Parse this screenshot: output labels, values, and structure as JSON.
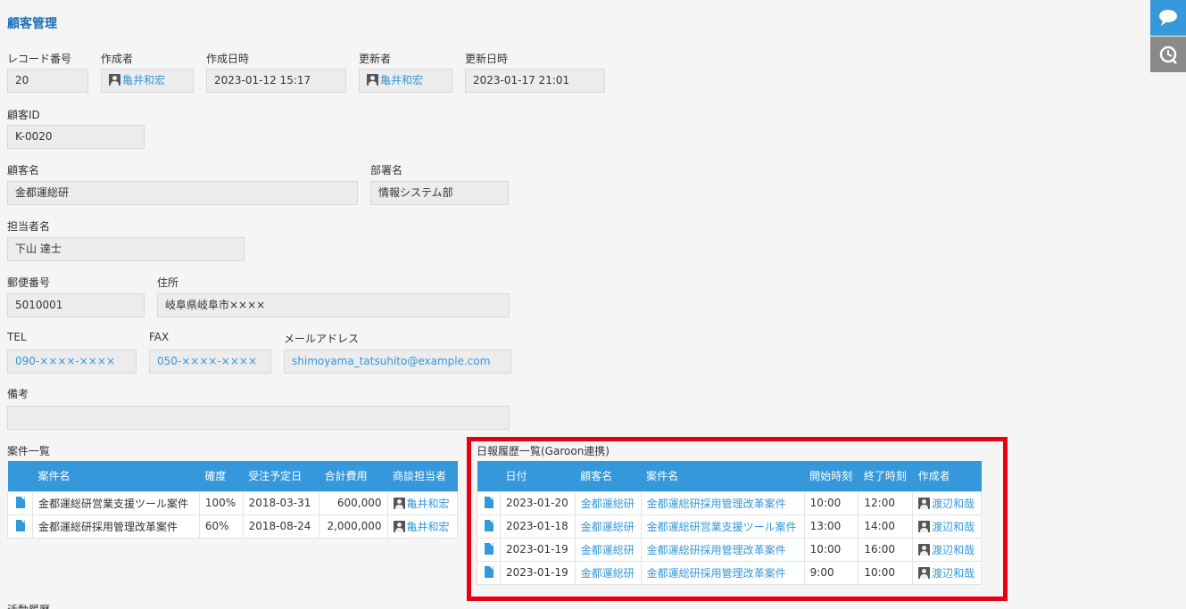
{
  "app": {
    "title": "顧客管理"
  },
  "fields": {
    "record_no": {
      "label": "レコード番号",
      "value": "20"
    },
    "creator": {
      "label": "作成者",
      "value": "亀井和宏"
    },
    "created_at": {
      "label": "作成日時",
      "value": "2023-01-12 15:17"
    },
    "updater": {
      "label": "更新者",
      "value": "亀井和宏"
    },
    "updated_at": {
      "label": "更新日時",
      "value": "2023-01-17 21:01"
    },
    "customer_id": {
      "label": "顧客ID",
      "value": "K-0020"
    },
    "customer_name": {
      "label": "顧客名",
      "value": "金都運総研"
    },
    "department": {
      "label": "部署名",
      "value": "情報システム部"
    },
    "contact_name": {
      "label": "担当者名",
      "value": "下山 達士"
    },
    "postal": {
      "label": "郵便番号",
      "value": "5010001"
    },
    "address": {
      "label": "住所",
      "value": "岐阜県岐阜市××××"
    },
    "tel": {
      "label": "TEL",
      "value": "090-××××-××××"
    },
    "fax": {
      "label": "FAX",
      "value": "050-××××-××××"
    },
    "email": {
      "label": "メールアドレス",
      "value": "shimoyama_tatsuhito@example.com"
    },
    "notes": {
      "label": "備考",
      "value": ""
    }
  },
  "deals": {
    "label": "案件一覧",
    "columns": [
      "案件名",
      "確度",
      "受注予定日",
      "合計費用",
      "商談担当者"
    ],
    "rows": [
      {
        "name": "金都運総研営業支援ツール案件",
        "prob": "100%",
        "date": "2018-03-31",
        "cost": "600,000",
        "owner": "亀井和宏"
      },
      {
        "name": "金都運総研採用管理改革案件",
        "prob": "60%",
        "date": "2018-08-24",
        "cost": "2,000,000",
        "owner": "亀井和宏"
      }
    ]
  },
  "reports": {
    "label": "日報履歴一覧(Garoon連携)",
    "columns": [
      "日付",
      "顧客名",
      "案件名",
      "開始時刻",
      "終了時刻",
      "作成者"
    ],
    "rows": [
      {
        "date": "2023-01-20",
        "customer": "金都運総研",
        "deal": "金都運総研採用管理改革案件",
        "start": "10:00",
        "end": "12:00",
        "author": "渡辺和哉"
      },
      {
        "date": "2023-01-18",
        "customer": "金都運総研",
        "deal": "金都運総研営業支援ツール案件",
        "start": "13:00",
        "end": "14:00",
        "author": "渡辺和哉"
      },
      {
        "date": "2023-01-19",
        "customer": "金都運総研",
        "deal": "金都運総研採用管理改革案件",
        "start": "10:00",
        "end": "16:00",
        "author": "渡辺和哉"
      },
      {
        "date": "2023-01-19",
        "customer": "金都運総研",
        "deal": "金都運総研採用管理改革案件",
        "start": "9:00",
        "end": "10:00",
        "author": "渡辺和哉"
      }
    ]
  },
  "activity": {
    "label": "活動履歴"
  },
  "side": {
    "comment_icon": "comment-icon",
    "history_icon": "history-icon"
  },
  "colors": {
    "accent": "#3498db",
    "highlight": "#e60012"
  }
}
